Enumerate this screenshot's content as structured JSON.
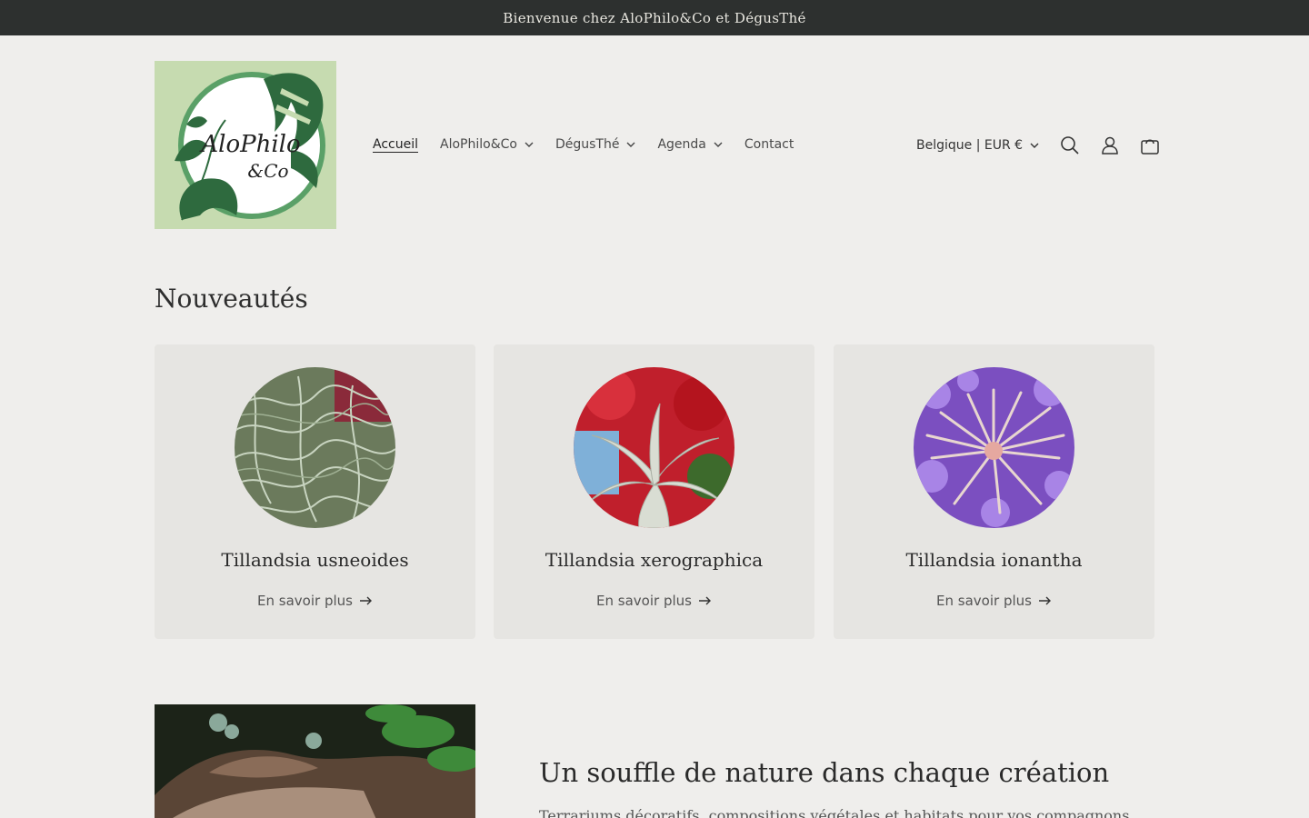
{
  "announcement": {
    "text": "Bienvenue chez AloPhilo&Co et DégusThé"
  },
  "logo": {
    "line1": "AloPhilo",
    "line2": "&Co",
    "colors": {
      "background": "#c6dbb0",
      "leaf": "#2e6a3e",
      "ring": "#5aa067"
    }
  },
  "nav": {
    "items": [
      {
        "label": "Accueil",
        "active": true,
        "dropdown": false
      },
      {
        "label": "AloPhilo&Co",
        "active": false,
        "dropdown": true
      },
      {
        "label": "DégusThé",
        "active": false,
        "dropdown": true
      },
      {
        "label": "Agenda",
        "active": false,
        "dropdown": true
      },
      {
        "label": "Contact",
        "active": false,
        "dropdown": false
      }
    ]
  },
  "utils": {
    "country": "Belgique | EUR €",
    "icons": [
      "search-icon",
      "account-icon",
      "cart-icon"
    ]
  },
  "section": {
    "title": "Nouveautés"
  },
  "products": [
    {
      "name": "Tillandsia usneoides",
      "link": "En savoir plus"
    },
    {
      "name": "Tillandsia xerographica",
      "link": "En savoir plus"
    },
    {
      "name": "Tillandsia ionantha",
      "link": "En savoir plus"
    }
  ],
  "feature": {
    "title": "Un souffle de nature dans chaque création",
    "text": "Terrariums décoratifs, compositions végétales et habitats pour vos compagnons"
  },
  "colors": {
    "announcement_bg": "#2d302f",
    "page_bg": "#efeeec",
    "card_bg": "#e6e5e2"
  }
}
